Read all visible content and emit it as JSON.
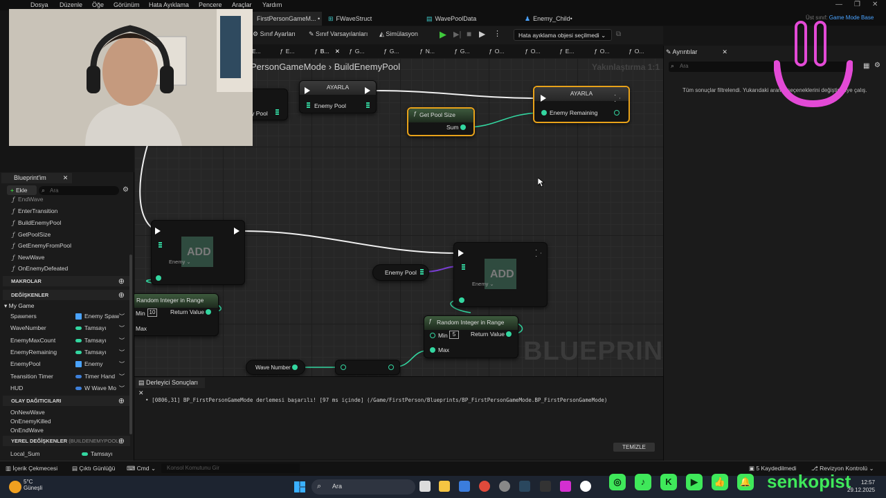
{
  "menu": [
    "Dosya",
    "Düzenle",
    "Öğe",
    "Görünüm",
    "Hata Ayıklama",
    "Pencere",
    "Araçlar",
    "Yardım"
  ],
  "doc_tabs": [
    {
      "label": "FirstPersonGameM... •",
      "active": true
    },
    {
      "label": "FWaveStruct"
    },
    {
      "label": "WavePoolData"
    },
    {
      "label": "Enemy_Child•"
    }
  ],
  "superclass": {
    "label": "Üst sınıf:",
    "value": "Game Mode Base"
  },
  "toolbar": {
    "class_settings": "Sınıf Ayarları",
    "class_defaults": "Sınıf Varsayılanları",
    "simulation": "Simülasyon",
    "debug_object": "Hata ayıklama objesi seçilmedi"
  },
  "graph_tabs": [
    "E...",
    "E...",
    "B...",
    "G...",
    "G...",
    "N...",
    "G...",
    "O...",
    "O...",
    "E...",
    "O...",
    "O..."
  ],
  "breadcrumb": {
    "class": "PersonGameMode",
    "sep": "›",
    "graph": "BuildEnemyPool"
  },
  "zoom": "Yakınlaştırma 1:1",
  "watermark": "BLUEPRINT",
  "nodes": {
    "set_top": {
      "title": "AYARLA",
      "pin": "Enemy Pool"
    },
    "partial_left": {
      "pin": "my Pool"
    },
    "get_pool_size": {
      "title": "Get Pool Size",
      "pin": "Sum"
    },
    "set_remaining": {
      "title": "AYARLA",
      "pin": "Enemy Remaining"
    },
    "add_left": {
      "title": "ADD",
      "type": "Enemy"
    },
    "add_right": {
      "title": "ADD",
      "type": "Enemy"
    },
    "enemy_pool_var": {
      "label": "Enemy Pool"
    },
    "random_left": {
      "title": "Random Integer in Range",
      "min_label": "Min",
      "min_value": "10",
      "max_label": "Max",
      "ret": "Return Value"
    },
    "random_right": {
      "title": "Random Integer in Range",
      "min_label": "Min",
      "min_value": "5",
      "max_label": "Max",
      "ret": "Return Value"
    },
    "wave_number": {
      "label": "Wave Number"
    }
  },
  "compiler": {
    "tab": "Derleyici Sonuçları",
    "message": "• [0806,31] BP_FirstPersonGameMode derlemesi başarılı! [97 ms içinde] (/Game/FirstPerson/Blueprints/BP_FirstPersonGameMode.BP_FirstPersonGameMode)",
    "clear": "TEMİZLE"
  },
  "details": {
    "tab": "Ayrıntılar",
    "search_placeholder": "Ara",
    "empty": "Tüm sonuçlar filtrelendi. Yukarıdaki arama seçeneklerini değiştirmeye çalış."
  },
  "my_blueprint": {
    "tab": "Blueprint'im",
    "add": "Ekle",
    "search_placeholder": "Ara",
    "functions": [
      "EndWave",
      "EnterTransition",
      "BuildEnemyPool",
      "GetPoolSize",
      "GetEnemyFromPool",
      "NewWave",
      "OnEnemyDefeated"
    ],
    "macros": "MAKROLAR",
    "variables_header": "DEĞİŞKENLER",
    "category": "My Game",
    "variables": [
      {
        "name": "Spawners",
        "type": "Enemy Spaw",
        "color": "#4aa3ff"
      },
      {
        "name": "WaveNumber",
        "type": "Tamsayı",
        "color": "#33d6a0"
      },
      {
        "name": "EnemyMaxCount",
        "type": "Tamsayı",
        "color": "#33d6a0"
      },
      {
        "name": "EnemyRemaining",
        "type": "Tamsayı",
        "color": "#33d6a0"
      },
      {
        "name": "EnemyPool",
        "type": "Enemy",
        "color": "#4aa3ff"
      },
      {
        "name": "Teansition Timer",
        "type": "Timer Hand",
        "color": "#3d7fd9"
      },
      {
        "name": "HUD",
        "type": "W Wave Mo",
        "color": "#3d7fd9"
      }
    ],
    "dispatchers_header": "OLAY DAĞITICILARI",
    "dispatchers": [
      "OnNewWave",
      "OnEnemyKilled",
      "OnEndWave"
    ],
    "locals_header": "YEREL DEĞİŞKENLER",
    "locals_sub": "(BUILDENEMYPOOL)",
    "locals": [
      {
        "name": "Local_Sum",
        "type": "Tamsayı"
      }
    ]
  },
  "statusbar": {
    "content_drawer": "İçerik Çekmecesi",
    "output_log": "Çıktı Günlüğü",
    "cmd": "Cmd",
    "console_placeholder": "Konsol Komutunu Gir",
    "saved": "5 Kaydedilmedi",
    "revision": "Revizyon Kontrolü"
  },
  "taskbar": {
    "weather_temp": "5°C",
    "weather_desc": "Güneşli",
    "search": "Ara",
    "time": "12:57",
    "date": "29.12.2025"
  },
  "stream": {
    "handle": "senkopist"
  },
  "colors": {
    "accent_green": "#3fe85a",
    "int_pin": "#33d6a0",
    "selection": "#e8a21a",
    "sticker": "#e34ad6"
  }
}
